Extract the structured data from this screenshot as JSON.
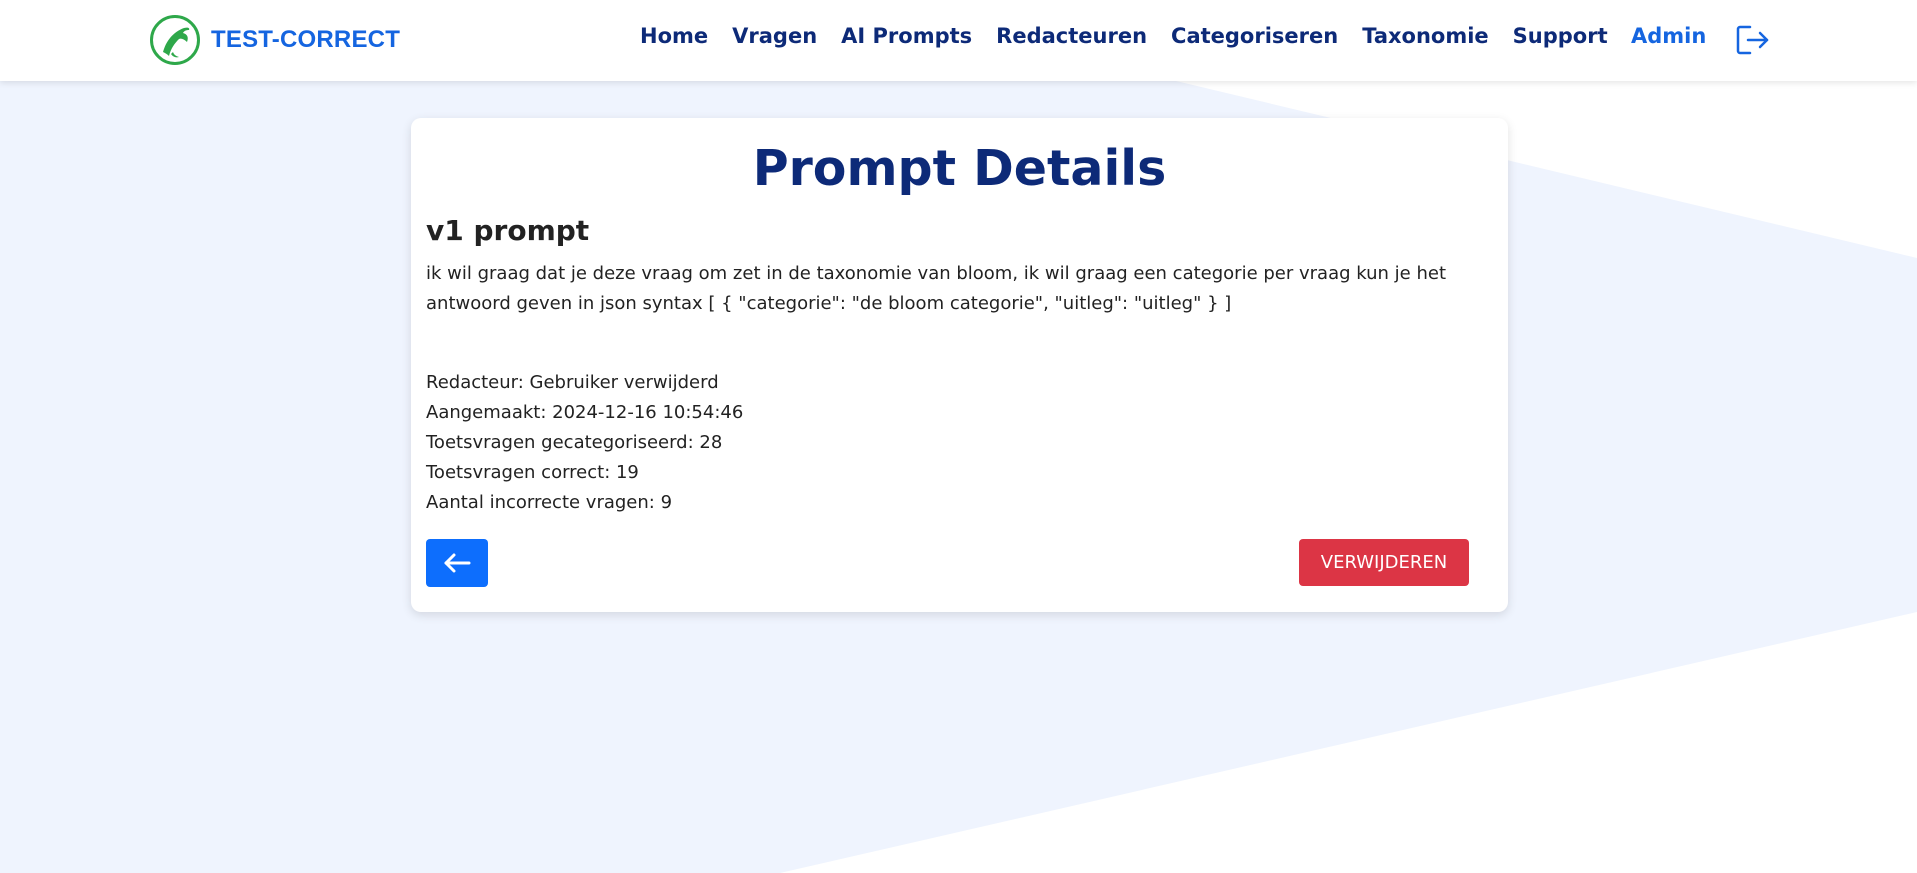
{
  "brand": {
    "name": "TEST-CORRECT",
    "logo_icon": "dolphin-icon",
    "color": "#1565e0",
    "logo_color": "#2ea84a"
  },
  "nav": {
    "links": [
      {
        "label": "Home"
      },
      {
        "label": "Vragen"
      },
      {
        "label": "AI Prompts"
      },
      {
        "label": "Redacteuren"
      },
      {
        "label": "Categoriseren"
      },
      {
        "label": "Taxonomie"
      },
      {
        "label": "Support"
      }
    ],
    "admin_label": "Admin",
    "logout_icon": "logout-icon"
  },
  "page": {
    "title": "Prompt Details",
    "prompt_name": "v1 prompt",
    "prompt_text": "ik wil graag dat je deze vraag om zet in de taxonomie van bloom, ik wil graag een categorie per vraag kun je het antwoord geven in json syntax [ { \"categorie\": \"de bloom categorie\", \"uitleg\": \"uitleg\" } ]",
    "meta": {
      "redacteur": "Redacteur: Gebruiker verwijderd",
      "aangemaakt": "Aangemaakt: 2024-12-16 10:54:46",
      "gecategoriseerd": "Toetsvragen gecategoriseerd: 28",
      "correct": "Toetsvragen correct: 19",
      "incorrect": "Aantal incorrecte vragen: 9"
    },
    "back_icon": "arrow-left-icon",
    "delete_label": "VERWIJDEREN"
  },
  "colors": {
    "primary": "#0d6efd",
    "danger": "#dc3545",
    "heading": "#0d2a78",
    "background_shape": "#eff4fe"
  }
}
